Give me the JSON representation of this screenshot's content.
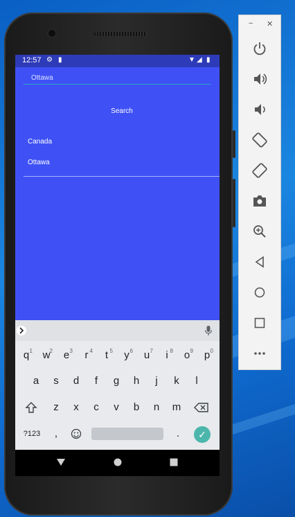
{
  "status_bar": {
    "time": "12:57"
  },
  "app": {
    "input_value": "Ottawa",
    "search_label": "Search",
    "results": [
      "Canada",
      "Ottawa"
    ]
  },
  "keyboard": {
    "row1": [
      {
        "k": "q",
        "h": "1"
      },
      {
        "k": "w",
        "h": "2"
      },
      {
        "k": "e",
        "h": "3"
      },
      {
        "k": "r",
        "h": "4"
      },
      {
        "k": "t",
        "h": "5"
      },
      {
        "k": "y",
        "h": "6"
      },
      {
        "k": "u",
        "h": "7"
      },
      {
        "k": "i",
        "h": "8"
      },
      {
        "k": "o",
        "h": "9"
      },
      {
        "k": "p",
        "h": "0"
      }
    ],
    "row2": [
      "a",
      "s",
      "d",
      "f",
      "g",
      "h",
      "j",
      "k",
      "l"
    ],
    "row3": [
      "z",
      "x",
      "c",
      "v",
      "b",
      "n",
      "m"
    ],
    "symbols_label": "?123",
    "comma": ",",
    "period": "."
  },
  "emulator_panel": {
    "icons": [
      "power-icon",
      "volume-up-icon",
      "volume-down-icon",
      "rotate-left-icon",
      "rotate-right-icon",
      "camera-icon",
      "zoom-icon",
      "back-icon",
      "home-icon",
      "overview-icon",
      "more-icon"
    ]
  }
}
